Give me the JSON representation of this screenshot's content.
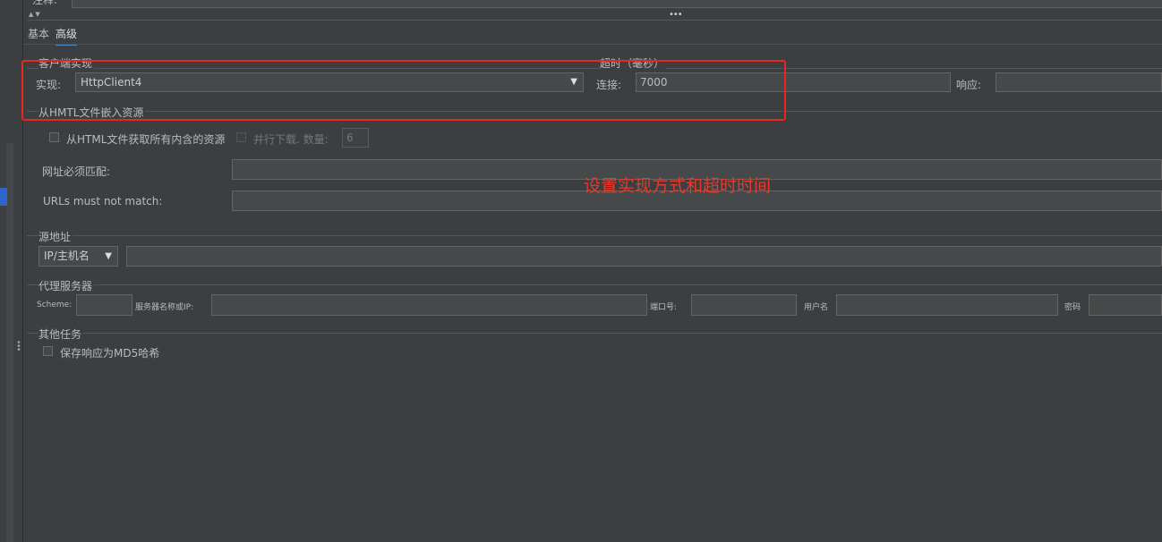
{
  "top": {
    "field_label": "注释:"
  },
  "tabs": [
    {
      "label": "基本"
    },
    {
      "label": "高级"
    }
  ],
  "client": {
    "group_title": "客户端实现",
    "impl_label": "实现:",
    "impl_value": "HttpClient4"
  },
  "timeout": {
    "group_title": "超时（毫秒）",
    "connect_label": "连接:",
    "connect_value": "7000",
    "response_label": "响应:",
    "response_value": ""
  },
  "embedded": {
    "group_title": "从HMTL文件嵌入资源",
    "fetch_all_label": "从HTML文件获取所有内含的资源",
    "parallel_label": "并行下载. 数量:",
    "parallel_count": "6",
    "must_match_label": "网址必须匹配:",
    "must_not_match_label": "URLs must not match:"
  },
  "source": {
    "group_title": "源地址",
    "type_value": "IP/主机名"
  },
  "proxy": {
    "group_title": "代理服务器",
    "scheme_label": "Scheme:",
    "server_label": "服务器名称或IP:",
    "port_label": "端口号:",
    "user_label": "用户名",
    "password_label": "密码"
  },
  "other": {
    "group_title": "其他任务",
    "md5_label": "保存响应为MD5哈希"
  },
  "annotation": {
    "text": "设置实现方式和超时时间",
    "color": "#e63a2c"
  },
  "colors": {
    "background": "#3c3f41",
    "field": "#45494a",
    "accent": "#4a88c7",
    "annotation": "#e8281c"
  },
  "icons": {
    "dropdown": "chevron-down-icon",
    "collapse": "collapse-arrows-icon",
    "splitter": "drag-handle-icon"
  }
}
